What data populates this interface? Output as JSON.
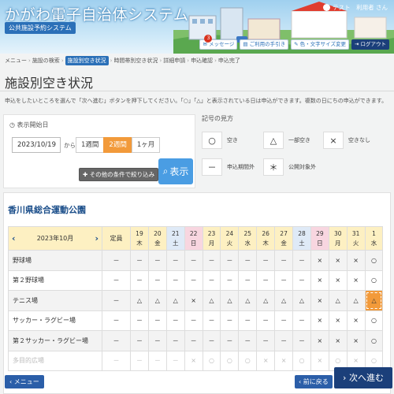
{
  "header": {
    "site_title": "かがわ電子自治体システム",
    "subtitle": "公共施設予約システム",
    "user_label": "テスト　利用者 さん",
    "buttons": {
      "message": "メッセージ",
      "message_count": "3",
      "guide": "ご利用の手引き",
      "color_size": "色・文字サイズ変更",
      "logout": "ログアウト"
    }
  },
  "breadcrumb": {
    "items": [
      "メニュー",
      "施設の検索",
      "施設別空き状況",
      "時間帯別空き状況",
      "詳細申請",
      "申込確認",
      "申込完了"
    ],
    "current_index": 2
  },
  "page_title": "施設別空き状況",
  "intro_text": "申込をしたいところを選んで「次へ進む」ボタンを押下してください。「○」「△」と表示されている日は申込ができます。複数の日にちの申込ができます。",
  "date_panel": {
    "label": "表示開始日",
    "date_value": "2023/10/19",
    "from_label": "から",
    "ranges": [
      "1週間",
      "2週間",
      "1ヶ月"
    ],
    "active_range": "2週間",
    "filter_button": "その他の条件で絞り込み",
    "show_button": "表示"
  },
  "legend": {
    "title": "記号の見方",
    "items": [
      {
        "symbol": "○",
        "label": "空き"
      },
      {
        "symbol": "△",
        "label": "一部空き"
      },
      {
        "symbol": "×",
        "label": "空きなし"
      },
      {
        "symbol": "－",
        "label": "申込期間外"
      },
      {
        "symbol": "＊",
        "label": "公開対象外"
      }
    ]
  },
  "facility": {
    "name": "香川県総合運動公園",
    "month_label": "2023年10月",
    "capacity_header": "定員",
    "days": [
      {
        "d": "19",
        "w": "木",
        "type": "normal"
      },
      {
        "d": "20",
        "w": "金",
        "type": "normal"
      },
      {
        "d": "21",
        "w": "土",
        "type": "sat"
      },
      {
        "d": "22",
        "w": "日",
        "type": "hol"
      },
      {
        "d": "23",
        "w": "月",
        "type": "normal"
      },
      {
        "d": "24",
        "w": "火",
        "type": "normal"
      },
      {
        "d": "25",
        "w": "水",
        "type": "normal"
      },
      {
        "d": "26",
        "w": "木",
        "type": "normal"
      },
      {
        "d": "27",
        "w": "金",
        "type": "normal"
      },
      {
        "d": "28",
        "w": "土",
        "type": "sat"
      },
      {
        "d": "29",
        "w": "日",
        "type": "hol"
      },
      {
        "d": "30",
        "w": "月",
        "type": "normal"
      },
      {
        "d": "31",
        "w": "火",
        "type": "normal"
      },
      {
        "d": "1",
        "w": "水",
        "type": "normal"
      }
    ],
    "rows": [
      {
        "name": "野球場",
        "cap": "－",
        "cells": [
          "－",
          "－",
          "－",
          "－",
          "－",
          "－",
          "－",
          "－",
          "－",
          "－",
          "×",
          "×",
          "×",
          "○"
        ]
      },
      {
        "name": "第２野球場",
        "cap": "－",
        "cells": [
          "－",
          "－",
          "－",
          "－",
          "－",
          "－",
          "－",
          "－",
          "－",
          "－",
          "×",
          "×",
          "×",
          "○"
        ]
      },
      {
        "name": "テニス場",
        "cap": "－",
        "cells": [
          "△",
          "△",
          "△",
          "×",
          "△",
          "△",
          "△",
          "△",
          "△",
          "△",
          "×",
          "△",
          "△",
          "△"
        ],
        "selected_index": 13
      },
      {
        "name": "サッカー・ラグビー場",
        "cap": "－",
        "cells": [
          "－",
          "－",
          "－",
          "－",
          "－",
          "－",
          "－",
          "－",
          "－",
          "－",
          "×",
          "×",
          "×",
          "○"
        ]
      },
      {
        "name": "第２サッカー・ラグビー場",
        "cap": "－",
        "cells": [
          "－",
          "－",
          "－",
          "－",
          "－",
          "－",
          "－",
          "－",
          "－",
          "－",
          "×",
          "×",
          "×",
          "○"
        ]
      },
      {
        "name": "多目的広場",
        "cap": "－",
        "cells": [
          "－",
          "－",
          "－",
          "×",
          "○",
          "○",
          "○",
          "×",
          "×",
          "○",
          "×",
          "○",
          "×",
          "○"
        ]
      }
    ]
  },
  "footer": {
    "menu_button": "メニュー",
    "back_button": "前に戻る",
    "next_button": "次へ進む"
  }
}
